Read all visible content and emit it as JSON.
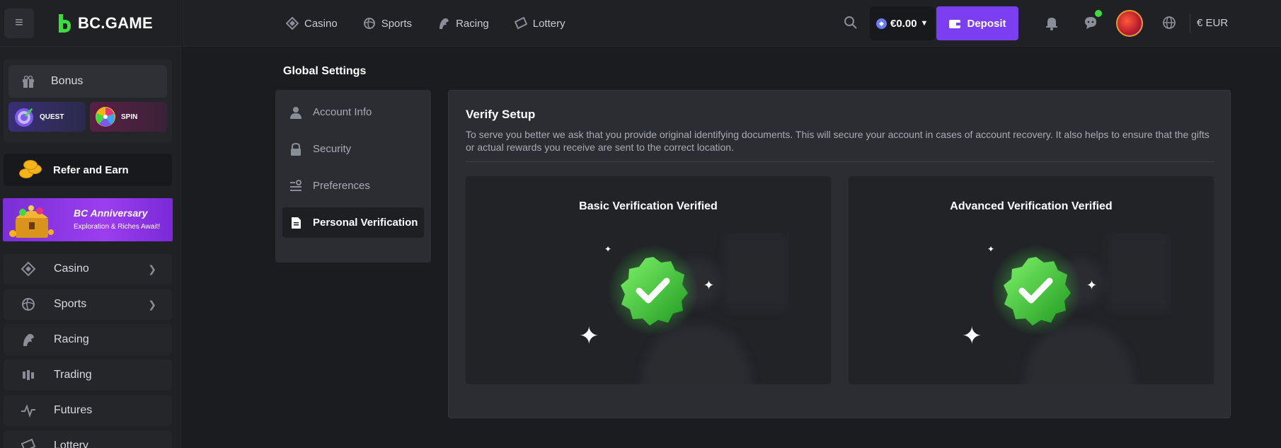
{
  "brand": {
    "name": "BC.GAME"
  },
  "sidebar": {
    "bonus_label": "Bonus",
    "quest_label": "QUEST",
    "spin_label": "SPIN",
    "refer_label": "Refer and Earn",
    "anniversary": {
      "title": "BC Anniversary",
      "subtitle": "Exploration & Riches Await!"
    },
    "items": [
      {
        "label": "Casino",
        "icon": "casino-icon",
        "has_chevron": true
      },
      {
        "label": "Sports",
        "icon": "sports-icon",
        "has_chevron": true
      },
      {
        "label": "Racing",
        "icon": "racing-icon",
        "has_chevron": false
      },
      {
        "label": "Trading",
        "icon": "trading-icon",
        "has_chevron": false
      },
      {
        "label": "Futures",
        "icon": "futures-icon",
        "has_chevron": false
      },
      {
        "label": "Lottery",
        "icon": "lottery-icon",
        "has_chevron": false
      }
    ]
  },
  "topbar": {
    "nav": [
      {
        "label": "Casino",
        "icon": "casino-icon"
      },
      {
        "label": "Sports",
        "icon": "sports-icon"
      },
      {
        "label": "Racing",
        "icon": "racing-icon"
      },
      {
        "label": "Lottery",
        "icon": "lottery-icon"
      }
    ],
    "balance": "€0.00",
    "deposit_label": "Deposit",
    "currency": "€ EUR"
  },
  "settings": {
    "page_title": "Global Settings",
    "menu": [
      {
        "label": "Account Info",
        "icon": "user-icon",
        "active": false
      },
      {
        "label": "Security",
        "icon": "lock-icon",
        "active": false
      },
      {
        "label": "Preferences",
        "icon": "preferences-icon",
        "active": false
      },
      {
        "label": "Personal Verification",
        "icon": "document-icon",
        "active": true
      }
    ]
  },
  "verify": {
    "title": "Verify Setup",
    "description": "To serve you better we ask that you provide original identifying documents. This will secure your account in cases of account recovery. It also helps to ensure that the gifts or actual rewards you receive are sent to the correct location.",
    "cards": [
      {
        "title": "Basic Verification Verified"
      },
      {
        "title": "Advanced Verification Verified"
      }
    ]
  },
  "colors": {
    "accent": "#7b3ef0",
    "brand_green": "#3ddc3d",
    "background": "#1a1c1f",
    "panel": "#2b2d33"
  }
}
